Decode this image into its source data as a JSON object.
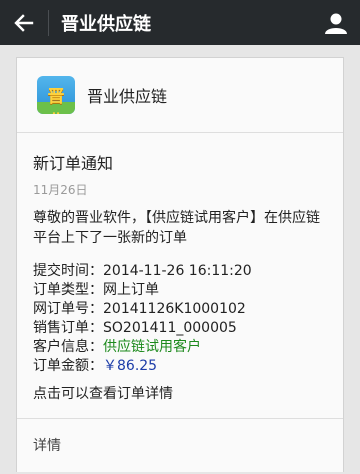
{
  "header": {
    "title": "晋业供应链"
  },
  "card": {
    "account_name": "晋业供应链",
    "logo_text": "晋业",
    "message_title": "新订单通知",
    "date": "11月26日",
    "intro": "尊敬的晋业软件，【供应链试用客户】在供应链平台上下了一张新的订单",
    "fields": [
      {
        "label": "提交时间：",
        "value": "2014-11-26 16:11:20"
      },
      {
        "label": "订单类型：",
        "value": "网上订单"
      },
      {
        "label": "网订单号：",
        "value": "20141126K1000102"
      },
      {
        "label": "销售订单：",
        "value": "SO201411_000005"
      },
      {
        "label": "客户信息：",
        "value": "供应链试用客户"
      },
      {
        "label": "订单金额：",
        "value": "￥86.25"
      }
    ],
    "hint": "点击可以查看订单详情",
    "detail_link": "详情"
  },
  "colors": {
    "topbar": "#262a2d",
    "customer_green": "#1d8a1d",
    "amount_blue": "#1c3ca8"
  },
  "icons": {
    "back": "back-arrow-icon",
    "profile": "person-icon"
  }
}
